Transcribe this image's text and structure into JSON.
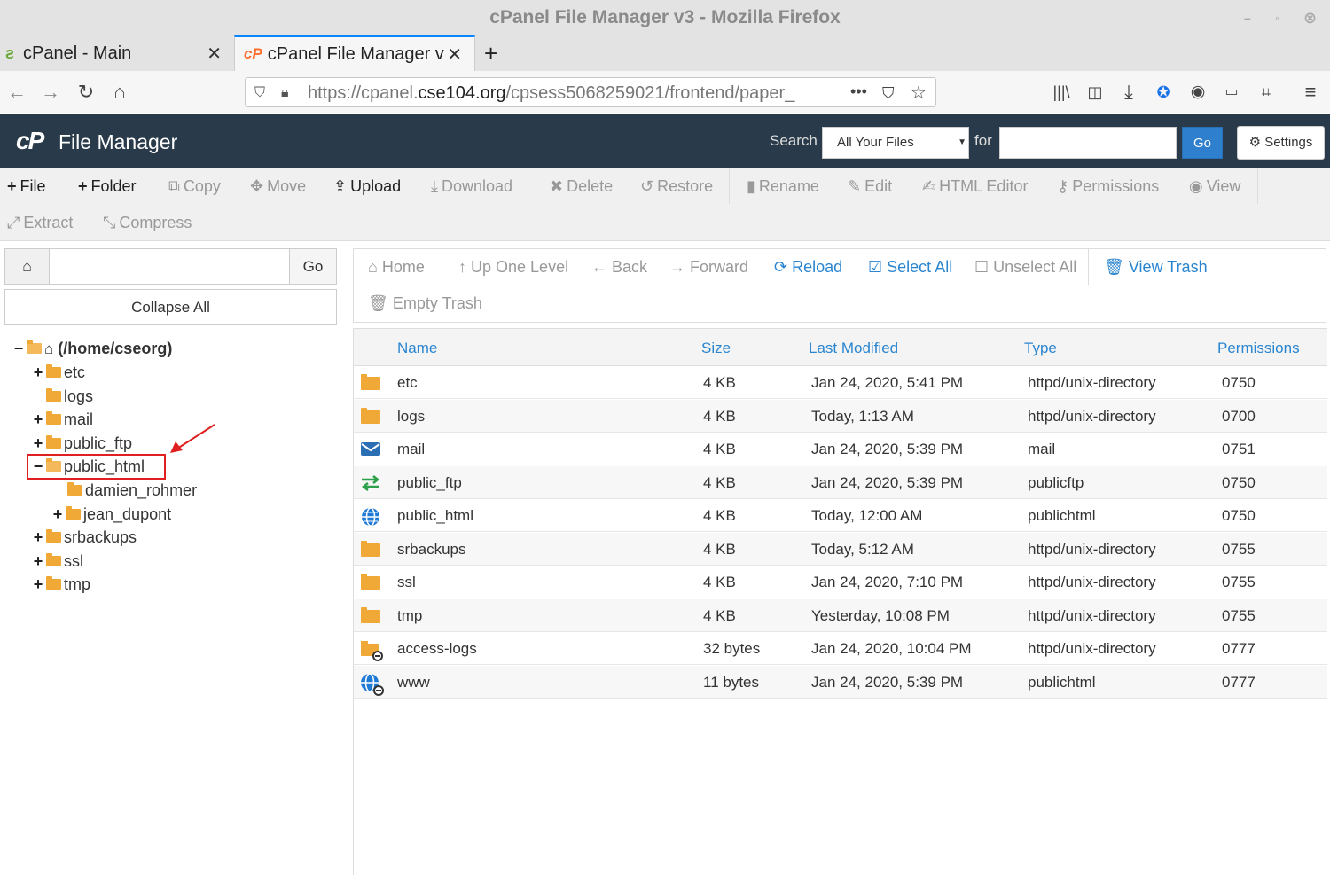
{
  "window": {
    "title": "cPanel File Manager v3 - Mozilla Firefox"
  },
  "tabs": [
    {
      "label": "cPanel - Main"
    },
    {
      "label": "cPanel File Manager v"
    }
  ],
  "url": {
    "prefix": "https://cpanel.",
    "domain": "cse104.org",
    "path": "/cpsess5068259021/frontend/paper_"
  },
  "header": {
    "logo": "cP",
    "title": "File Manager",
    "search_label": "Search",
    "search_scope": "All Your Files",
    "for_label": "for",
    "go_label": "Go",
    "settings_label": "Settings"
  },
  "toolbar": {
    "file": "File",
    "folder": "Folder",
    "copy": "Copy",
    "move": "Move",
    "upload": "Upload",
    "download": "Download",
    "delete": "Delete",
    "restore": "Restore",
    "rename": "Rename",
    "edit": "Edit",
    "html_editor": "HTML Editor",
    "permissions": "Permissions",
    "view": "View",
    "extract": "Extract",
    "compress": "Compress"
  },
  "left": {
    "go_label": "Go",
    "collapse_all": "Collapse All",
    "tree": {
      "root": "(/home/cseorg)",
      "items": [
        "etc",
        "logs",
        "mail",
        "public_ftp",
        "public_html",
        "damien_rohmer",
        "jean_dupont",
        "srbackups",
        "ssl",
        "tmp"
      ]
    }
  },
  "rnav": {
    "home": "Home",
    "up": "Up One Level",
    "back": "Back",
    "forward": "Forward",
    "reload": "Reload",
    "select_all": "Select All",
    "unselect_all": "Unselect All",
    "view_trash": "View Trash",
    "empty_trash": "Empty Trash"
  },
  "table": {
    "headers": {
      "name": "Name",
      "size": "Size",
      "modified": "Last Modified",
      "type": "Type",
      "perms": "Permissions"
    },
    "rows": [
      {
        "icon": "folder-icon",
        "name": "etc",
        "size": "4 KB",
        "modified": "Jan 24, 2020, 5:41 PM",
        "type": "httpd/unix-directory",
        "perms": "0750"
      },
      {
        "icon": "folder-icon",
        "name": "logs",
        "size": "4 KB",
        "modified": "Today, 1:13 AM",
        "type": "httpd/unix-directory",
        "perms": "0700"
      },
      {
        "icon": "envelope-icon",
        "name": "mail",
        "size": "4 KB",
        "modified": "Jan 24, 2020, 5:39 PM",
        "type": "mail",
        "perms": "0751"
      },
      {
        "icon": "transfer-arrows-icon",
        "name": "public_ftp",
        "size": "4 KB",
        "modified": "Jan 24, 2020, 5:39 PM",
        "type": "publicftp",
        "perms": "0750"
      },
      {
        "icon": "globe-icon",
        "name": "public_html",
        "size": "4 KB",
        "modified": "Today, 12:00 AM",
        "type": "publichtml",
        "perms": "0750"
      },
      {
        "icon": "folder-icon",
        "name": "srbackups",
        "size": "4 KB",
        "modified": "Today, 5:12 AM",
        "type": "httpd/unix-directory",
        "perms": "0755"
      },
      {
        "icon": "folder-icon",
        "name": "ssl",
        "size": "4 KB",
        "modified": "Jan 24, 2020, 7:10 PM",
        "type": "httpd/unix-directory",
        "perms": "0755"
      },
      {
        "icon": "folder-icon",
        "name": "tmp",
        "size": "4 KB",
        "modified": "Yesterday, 10:08 PM",
        "type": "httpd/unix-directory",
        "perms": "0755"
      },
      {
        "icon": "folder-link-icon",
        "name": "access-logs",
        "size": "32 bytes",
        "modified": "Jan 24, 2020, 10:04 PM",
        "type": "httpd/unix-directory",
        "perms": "0777"
      },
      {
        "icon": "globe-link-icon",
        "name": "www",
        "size": "11 bytes",
        "modified": "Jan 24, 2020, 5:39 PM",
        "type": "publichtml",
        "perms": "0777"
      }
    ]
  },
  "colors": {
    "accent": "#2a85d0",
    "header_bg": "#293a4a",
    "folder": "#f0a836",
    "highlight": "#e02020"
  }
}
